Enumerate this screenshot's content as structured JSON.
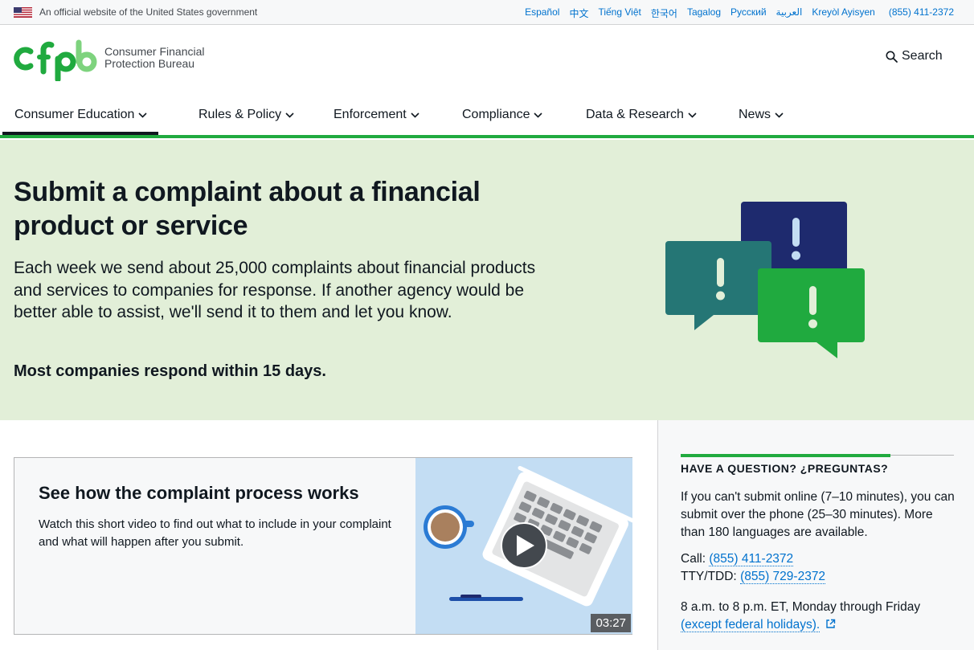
{
  "banner": {
    "gov_text": "An official website of the United States government",
    "languages": [
      "Español",
      "中文",
      "Tiếng Việt",
      "한국어",
      "Tagalog",
      "Русский",
      "العربية",
      "Kreyòl Ayisyen"
    ],
    "phone": "(855) 411-2372"
  },
  "header": {
    "logo_line1": "Consumer Financial",
    "logo_line2": "Protection Bureau",
    "search_label": "Search"
  },
  "nav": {
    "items": [
      "Consumer Education",
      "Rules & Policy",
      "Enforcement",
      "Compliance",
      "Data & Research",
      "News"
    ],
    "active_index": 0
  },
  "hero": {
    "title": "Submit a complaint about a financial product or service",
    "body": "Each week we send about 25,000 complaints about financial products and services to companies for response. If another agency would be better able to assist, we'll send it to them and let you know.",
    "strong": "Most companies respond within 15 days."
  },
  "video": {
    "heading": "See how the complaint process works",
    "description": "Watch this short video to find out what to include in your complaint and what will happen after you submit.",
    "duration": "03:27"
  },
  "sidebar": {
    "heading": "HAVE A QUESTION? ¿PREGUNTAS?",
    "text": "If you can't submit online (7–10 minutes), you can submit over the phone (25–30 minutes). More than 180 languages are available.",
    "call_label": "Call: ",
    "call_number": "(855) 411-2372",
    "tty_label": "TTY/TDD: ",
    "tty_number": "(855) 729-2372",
    "hours": "8 a.m. to 8 p.m. ET, Monday through Friday",
    "holidays_link": "(except federal holidays)."
  },
  "colors": {
    "brand_green": "#20aa3f",
    "hero_bg": "#e2efd8",
    "link_blue": "#0072ce",
    "navy": "#1e2a6e",
    "teal": "#257675"
  }
}
